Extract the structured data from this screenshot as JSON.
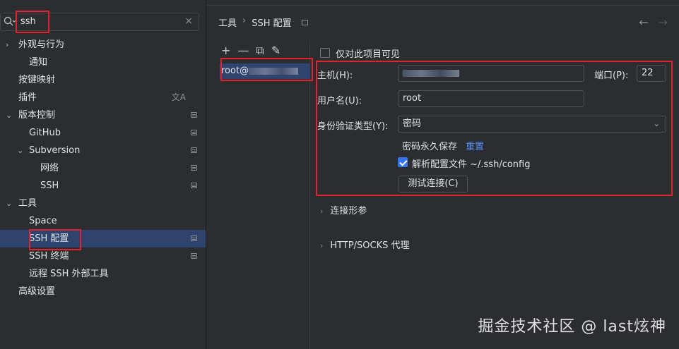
{
  "search": {
    "query": "ssh"
  },
  "tree": [
    {
      "label": "外观与行为",
      "level": 0,
      "arrow": "›",
      "pin": false
    },
    {
      "label": "通知",
      "level": 2,
      "pin": false
    },
    {
      "label": "按键映射",
      "level": 1,
      "pin": false
    },
    {
      "label": "插件",
      "level": 1,
      "pin": false,
      "translate": true
    },
    {
      "label": "版本控制",
      "level": 0,
      "arrow": "⌄",
      "pin": true
    },
    {
      "label": "GitHub",
      "level": 2,
      "pin": true
    },
    {
      "label": "Subversion",
      "level": 2,
      "arrow": "⌄",
      "pin": true
    },
    {
      "label": "网络",
      "level": 3,
      "pin": true
    },
    {
      "label": "SSH",
      "level": 3,
      "pin": true
    },
    {
      "label": "工具",
      "level": 0,
      "arrow": "⌄",
      "pin": false
    },
    {
      "label": "Space",
      "level": 2,
      "pin": false
    },
    {
      "label": "SSH 配置",
      "level": 2,
      "pin": true,
      "selected": true
    },
    {
      "label": "SSH 终端",
      "level": 2,
      "pin": true
    },
    {
      "label": "远程 SSH 外部工具",
      "level": 2,
      "pin": false
    },
    {
      "label": "高级设置",
      "level": 1,
      "pin": false
    }
  ],
  "breadcrumb": {
    "parent": "工具",
    "separator": "›",
    "current": "SSH 配置"
  },
  "host_list": {
    "tools": [
      "+",
      "—",
      "⧉",
      "✎"
    ],
    "entry": "root@"
  },
  "form": {
    "project_only": "仅对此项目可见",
    "host_label": "主机(H):",
    "port_label": "端口(P):",
    "port_value": "22",
    "username_label": "用户名(U):",
    "username_value": "root",
    "auth_label": "身份验证类型(Y):",
    "auth_value": "密码",
    "save_password": "密码永久保存",
    "reset": "重置",
    "parse_config": "解析配置文件 ~/.ssh/config",
    "test_button": "测试连接(C)"
  },
  "sections": {
    "connection": "连接形参",
    "proxy": "HTTP/SOCKS 代理"
  },
  "watermark": "掘金技术社区 @ last炫神",
  "colors": {
    "accent": "#3574f0",
    "selection": "#2e436e",
    "annotation": "#e0242f",
    "link": "#548af7"
  }
}
